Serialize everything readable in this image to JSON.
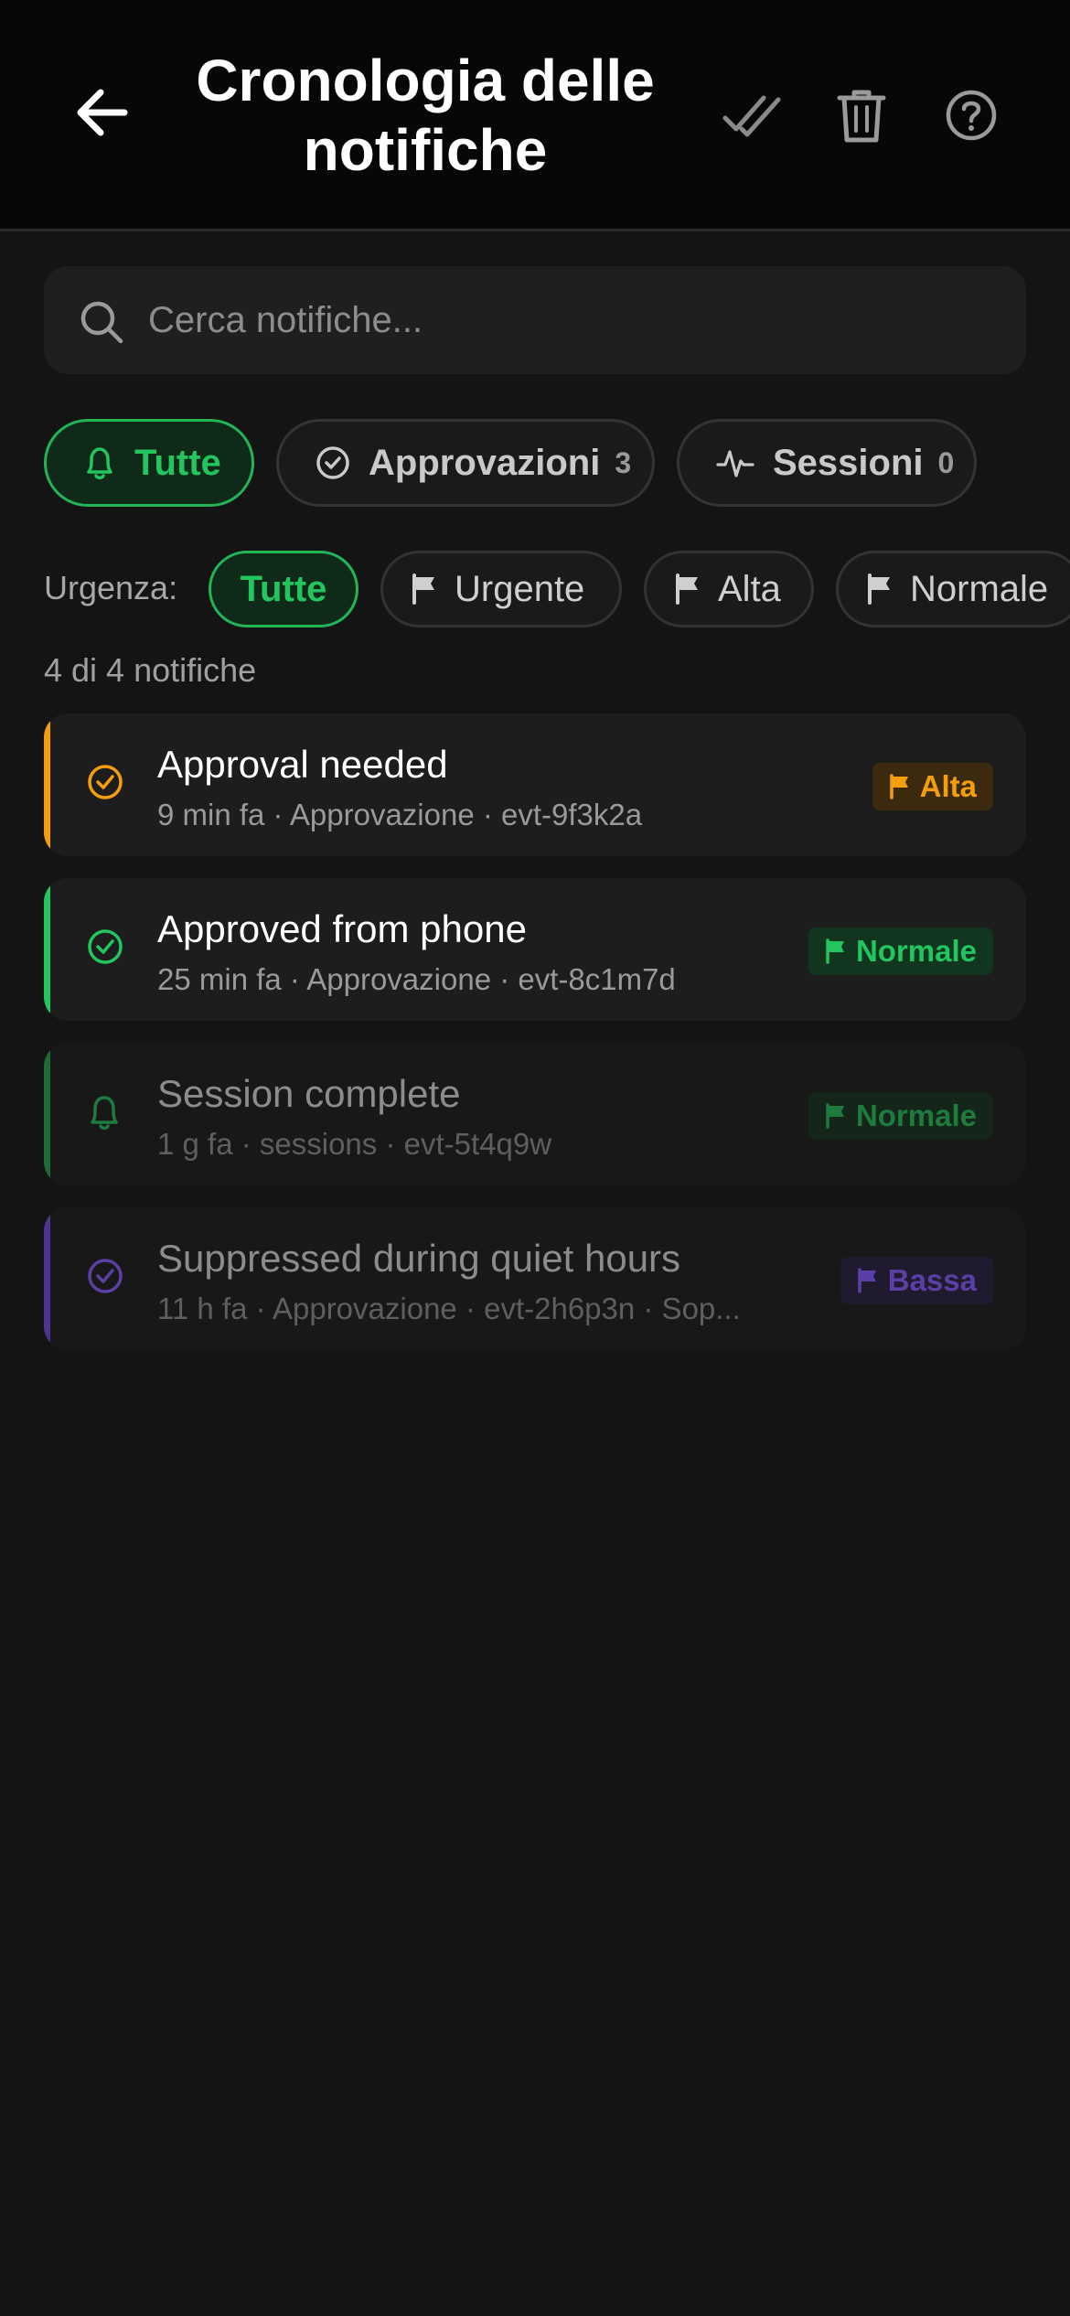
{
  "header": {
    "title": "Cronologia delle notifiche",
    "back_icon": "arrow-left-icon",
    "actions": [
      "mark-all-read-icon",
      "trash-icon",
      "help-circle-icon"
    ]
  },
  "search": {
    "placeholder": "Cerca notifiche...",
    "value": ""
  },
  "tabs": [
    {
      "label": "Tutte",
      "icon": "bell-icon",
      "count": "",
      "active": true
    },
    {
      "label": "Approvazioni",
      "icon": "check-circle-icon",
      "count": "3",
      "active": false
    },
    {
      "label": "Sessioni",
      "icon": "activity-icon",
      "count": "0",
      "active": false
    }
  ],
  "urgency": {
    "label": "Urgenza:",
    "chips": [
      {
        "label": "Tutte",
        "active": true
      },
      {
        "label": "Urgente",
        "icon": "flag-icon"
      },
      {
        "label": "Alta",
        "icon": "flag-icon"
      },
      {
        "label": "Normale",
        "icon": "flag-icon"
      }
    ]
  },
  "summary": "4 di 4 notifiche",
  "notifications": [
    {
      "title": "Approval needed",
      "meta": "9 min fa · Approvazione · evt-9f3k2a",
      "badge": "Alta",
      "icon": "check-circle-icon",
      "accent": "#f59e0b"
    },
    {
      "title": "Approved from phone",
      "meta": "25 min fa · Approvazione · evt-8c1m7d",
      "badge": "Normale",
      "icon": "check-circle-icon",
      "accent": "#22c55e"
    },
    {
      "title": "Session complete",
      "meta": "1 g fa · sessions · evt-5t4q9w",
      "badge": "Normale",
      "icon": "bell-icon",
      "accent": "#1f7a3d"
    },
    {
      "title": "Suppressed during quiet hours",
      "meta": "11 h fa · Approvazione · evt-2h6p3n · Sop...",
      "badge": "Bassa",
      "icon": "check-circle-icon",
      "accent": "#5b3fa6"
    }
  ],
  "colors": {
    "accent_green": "#22c55e",
    "high_orange": "#f59e0b",
    "low_purple": "#5b3fa6",
    "background": "#141414"
  }
}
